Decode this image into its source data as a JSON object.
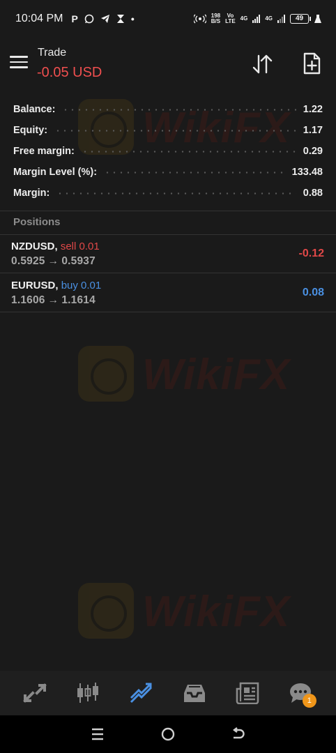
{
  "status_bar": {
    "time": "10:04 PM",
    "data_speed_top": "198",
    "data_speed_bottom": "B/S",
    "volte_top": "Vo",
    "volte_bottom": "LTE",
    "net_1": "4G",
    "net_2": "4G",
    "battery": "49"
  },
  "header": {
    "title": "Trade",
    "pnl": "-0.05 USD",
    "pnl_color": "#ef4f4f"
  },
  "summary": {
    "rows": [
      {
        "label": "Balance:",
        "value": "1.22"
      },
      {
        "label": "Equity:",
        "value": "1.17"
      },
      {
        "label": "Free margin:",
        "value": "0.29"
      },
      {
        "label": "Margin Level (%):",
        "value": "133.48"
      },
      {
        "label": "Margin:",
        "value": "0.88"
      }
    ]
  },
  "positions": {
    "title": "Positions",
    "items": [
      {
        "symbol": "NZDUSD,",
        "side": "sell 0.01",
        "open": "0.5925",
        "arrow": "→",
        "current": "0.5937",
        "profit": "-0.12",
        "direction": "sell"
      },
      {
        "symbol": "EURUSD,",
        "side": "buy 0.01",
        "open": "1.1606",
        "arrow": "→",
        "current": "1.1614",
        "profit": "0.08",
        "direction": "buy"
      }
    ]
  },
  "bottom_nav": {
    "items": [
      {
        "icon": "quotes-icon"
      },
      {
        "icon": "chart-candles-icon"
      },
      {
        "icon": "trade-icon",
        "active": true
      },
      {
        "icon": "history-inbox-icon"
      },
      {
        "icon": "news-icon"
      },
      {
        "icon": "messages-icon",
        "badge": "1"
      }
    ]
  },
  "watermark": {
    "text": "WikiFX"
  },
  "colors": {
    "sell": "#e04848",
    "buy": "#4a90e2",
    "accent": "#4a90e2",
    "background": "#1a1a1a",
    "badge": "#f0961a"
  }
}
